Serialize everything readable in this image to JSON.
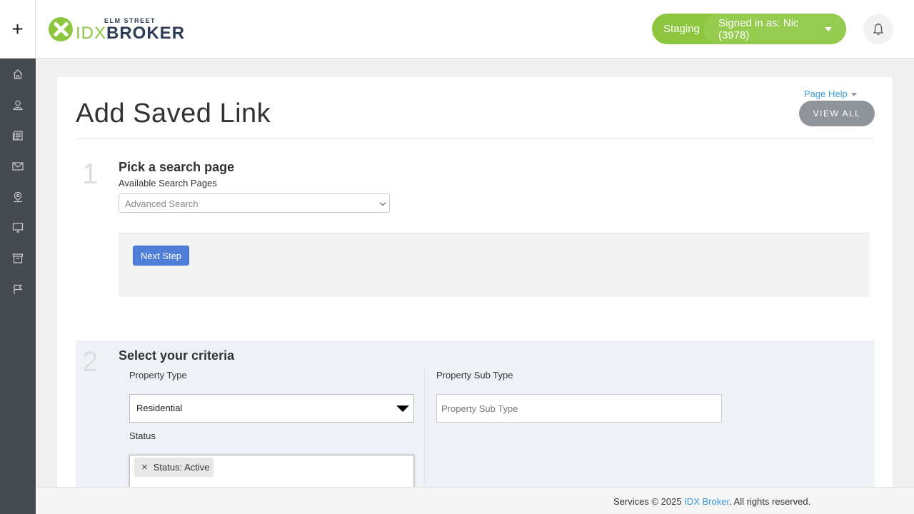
{
  "header": {
    "add_icon": "plus-icon",
    "logo_small": "ELM STREET",
    "logo_idx": "IDX",
    "logo_broker": "BROKER",
    "env_label": "Staging",
    "signed_in": "Signed in as: Nic (3978)",
    "bell_icon": "bell-icon"
  },
  "sidebar": {
    "items": [
      {
        "icon": "home-icon"
      },
      {
        "icon": "user-icon"
      },
      {
        "icon": "newspaper-icon"
      },
      {
        "icon": "envelope-icon"
      },
      {
        "icon": "map-pin-icon"
      },
      {
        "icon": "monitor-icon"
      },
      {
        "icon": "archive-icon"
      },
      {
        "icon": "flag-icon"
      }
    ]
  },
  "page": {
    "title": "Add Saved Link",
    "page_help": "Page Help",
    "view_all": "VIEW ALL"
  },
  "step1": {
    "number": "1",
    "heading": "Pick a search page",
    "label": "Available Search Pages",
    "selected": "Advanced Search",
    "next_button": "Next Step"
  },
  "step2": {
    "number": "2",
    "heading": "Select your criteria",
    "property_type_label": "Property Type",
    "property_type_value": "Residential",
    "property_sub_type_label": "Property Sub Type",
    "property_sub_type_placeholder": "Property Sub Type",
    "status_label": "Status",
    "status_chip": "Status: Active",
    "status_chip_remove": "×"
  },
  "footer": {
    "prefix": "Services © 2025 ",
    "link": "IDX Broker",
    "suffix": ". All rights reserved."
  },
  "colors": {
    "brand_green": "#8cc63f",
    "sidebar": "#454a4f",
    "primary_button": "#4f7fd8",
    "link": "#3a9ad9"
  }
}
